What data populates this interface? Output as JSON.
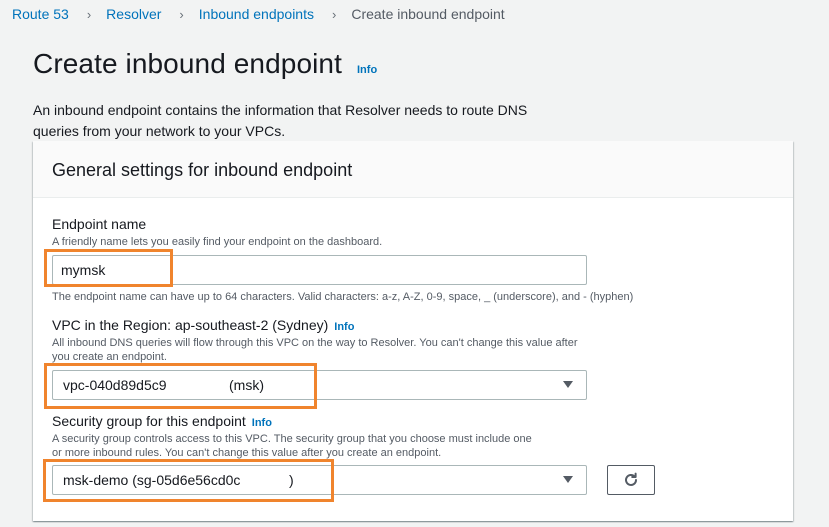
{
  "breadcrumb": {
    "items": [
      "Route 53",
      "Resolver",
      "Inbound endpoints"
    ],
    "current": "Create inbound endpoint",
    "separator": "›"
  },
  "page": {
    "title": "Create inbound endpoint",
    "info_label": "Info",
    "description": "An inbound endpoint contains the information that Resolver needs to route DNS queries from your network to your VPCs."
  },
  "panel": {
    "title": "General settings for inbound endpoint"
  },
  "endpoint_name": {
    "label": "Endpoint name",
    "description": "A friendly name lets you easily find your endpoint on the dashboard.",
    "value": "mymsk",
    "constraint": "The endpoint name can have up to 64 characters. Valid characters: a-z, A-Z, 0-9, space, _ (underscore), and - (hyphen)"
  },
  "vpc": {
    "label": "VPC in the Region: ap-southeast-2 (Sydney)",
    "info_label": "Info",
    "description": "All inbound DNS queries will flow through this VPC on the way to Resolver. You can't change this value after you create an endpoint.",
    "selected_id": "vpc-040d89d5c9",
    "selected_name": "(msk)"
  },
  "security_group": {
    "label": "Security group for this endpoint",
    "info_label": "Info",
    "description": "A security group controls access to this VPC. The security group that you choose must include one or more inbound rules. You can't change this value after you create an endpoint.",
    "selected_name": "msk-demo (sg-05d6e56cd0c",
    "selected_close": ")"
  },
  "colors": {
    "highlight": "#f0842d",
    "link": "#0073bb"
  },
  "icons": {
    "dropdown": "caret-down-icon",
    "refresh": "refresh-icon"
  }
}
